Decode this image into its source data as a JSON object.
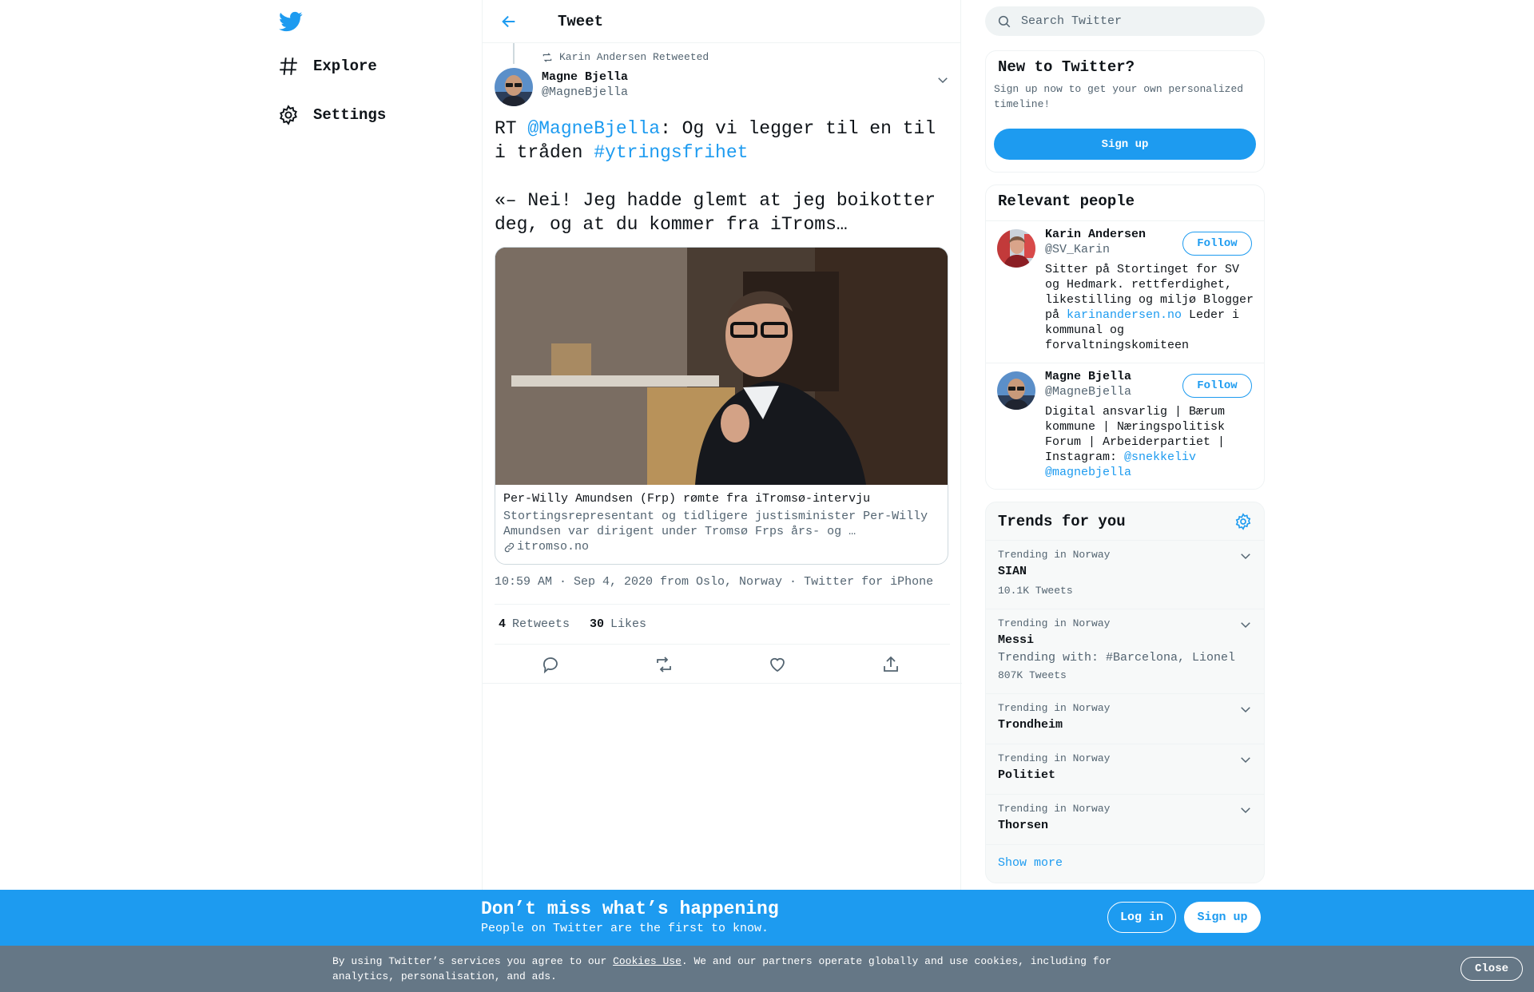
{
  "nav": {
    "explore": "Explore",
    "settings": "Settings"
  },
  "header": {
    "title": "Tweet"
  },
  "tweet": {
    "retweeted_by": "Karin Andersen Retweeted",
    "author_name": "Magne Bjella",
    "author_handle": "@MagneBjella",
    "text_prefix": "RT ",
    "mention": "@MagneBjella",
    "text_mid": ": Og vi legger til en til i tråden ",
    "hashtag": "#ytringsfrihet",
    "text_rest": "\n\n«– Nei! Jeg hadde glemt at jeg boikotter deg, og at du kommer fra iTroms…",
    "card": {
      "title": "Per-Willy Amundsen (Frp) rømte fra iTromsø-intervju",
      "description": "Stortingsrepresentant og tidligere justisminister Per-Willy Amundsen var dirigent under Tromsø Frps års- og …",
      "domain": "itromso.no"
    },
    "time": "10:59 AM · Sep 4, 2020 from Oslo, Norway · Twitter for iPhone",
    "retweets_count": "4",
    "retweets_label": "Retweets",
    "likes_count": "30",
    "likes_label": "Likes"
  },
  "search": {
    "placeholder": "Search Twitter"
  },
  "new_to_twitter": {
    "title": "New to Twitter?",
    "description": "Sign up now to get your own personalized timeline!",
    "signup": "Sign up"
  },
  "relevant_people": {
    "title": "Relevant people",
    "people": [
      {
        "name": "Karin Andersen",
        "handle": "@SV_Karin",
        "follow": "Follow",
        "bio_text": "Sitter på Stortinget for SV og Hedmark. rettferdighet, likestilling og miljø Blogger på ",
        "bio_link": "karinandersen.no",
        "bio_after": " Leder i kommunal og forvaltningskomiteen"
      },
      {
        "name": "Magne Bjella",
        "handle": "@MagneBjella",
        "follow": "Follow",
        "bio_text": "Digital ansvarlig | Bærum kommune | Næringspolitisk Forum | Arbeiderpartiet | Instagram: ",
        "bio_link": "@snekkeliv",
        "bio_link2": "@magnebjella"
      }
    ]
  },
  "trends": {
    "title": "Trends for you",
    "items": [
      {
        "context": "Trending in Norway",
        "name": "SIAN",
        "with": "",
        "count": "10.1K Tweets"
      },
      {
        "context": "Trending in Norway",
        "name": "Messi",
        "with": "Trending with: #Barcelona, Lionel",
        "count": "807K Tweets"
      },
      {
        "context": "Trending in Norway",
        "name": "Trondheim",
        "with": "",
        "count": ""
      },
      {
        "context": "Trending in Norway",
        "name": "Politiet",
        "with": "",
        "count": ""
      },
      {
        "context": "Trending in Norway",
        "name": "Thorsen",
        "with": "",
        "count": ""
      }
    ],
    "show_more": "Show more"
  },
  "banner": {
    "title": "Don’t miss what’s happening",
    "subtitle": "People on Twitter are the first to know.",
    "login": "Log in",
    "signup": "Sign up"
  },
  "cookie": {
    "text_before": "By using Twitter’s services you agree to our ",
    "link": "Cookies Use",
    "text_after": ". We and our partners operate globally and use cookies, including for analytics, personalisation, and ads.",
    "close": "Close"
  },
  "colors": {
    "accent": "#1d9bf0",
    "cookie_bar": "#657786",
    "text_secondary": "#536471"
  }
}
